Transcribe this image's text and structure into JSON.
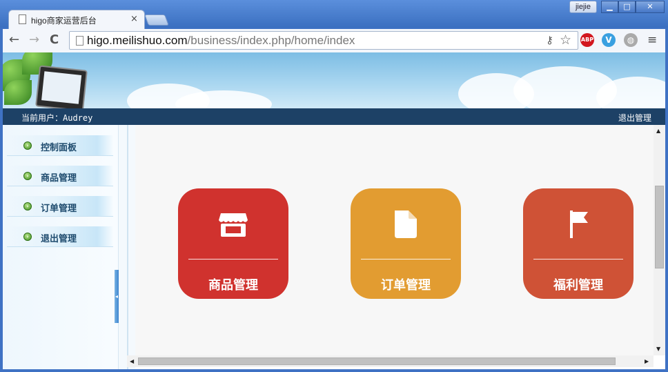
{
  "browser": {
    "tab_title": "higo商家运营后台",
    "tab_close": "×",
    "profile_name": "jiejie",
    "window_buttons": {
      "minimize": "▁",
      "maximize": "□",
      "close": "✕"
    },
    "nav": {
      "back": "←",
      "forward": "→",
      "reload": "C"
    },
    "url_host": "higo.meilishuo.com",
    "url_path": "/business/index.php/home/index",
    "extensions": {
      "abp": "ABP",
      "v": "V",
      "globe": "◍"
    },
    "menu": "≡",
    "star": "☆",
    "key": "⚷"
  },
  "header": {
    "current_user_text": "当前用户：Audrey",
    "logout_text": "退出管理"
  },
  "sidebar": {
    "items": [
      {
        "label": "控制面板",
        "bullet": "›"
      },
      {
        "label": "商品管理",
        "bullet": "›"
      },
      {
        "label": "订单管理",
        "bullet": "›"
      },
      {
        "label": "退出管理",
        "bullet": "›"
      }
    ],
    "handle": "◂"
  },
  "tiles": [
    {
      "label": "商品管理",
      "icon": "store-icon",
      "color": "#d0322e"
    },
    {
      "label": "订单管理",
      "icon": "document-icon",
      "color": "#e29c31"
    },
    {
      "label": "福利管理",
      "icon": "flag-icon",
      "color": "#cf5236"
    }
  ],
  "scrollbars": {
    "up": "▲",
    "down": "▼",
    "left": "◀",
    "right": "▶"
  }
}
